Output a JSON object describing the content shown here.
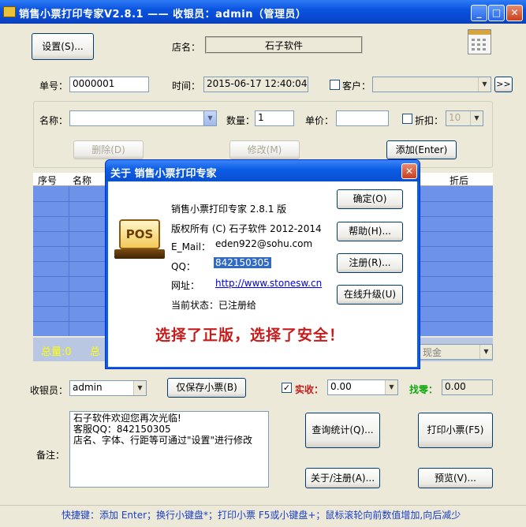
{
  "window": {
    "title": "销售小票打印专家V2.8.1 —— 收银员：admin（管理员）",
    "min": "_",
    "max": "□",
    "close": "✕"
  },
  "toolbar": {
    "settings_button": "设置(S)...",
    "store_label": "店名：",
    "store_name": "石子软件"
  },
  "order": {
    "number_label": "单号：",
    "number_value": "0000001",
    "time_label": "时间：",
    "time_value": "2015-06-17 12:40:04",
    "customer_label": "客户：",
    "customer_value": "",
    "more_button": ">>"
  },
  "item": {
    "name_label": "名称：",
    "name_value": "",
    "qty_label": "数量：",
    "qty_value": "1",
    "price_label": "单价：",
    "price_value": "",
    "discount_label": "折扣：",
    "discount_value": "10",
    "delete_button": "删除(D)",
    "modify_button": "修改(M)",
    "add_button": "添加(Enter)"
  },
  "grid": {
    "col_seq": "序号",
    "col_name": "名称",
    "col_after": "折后"
  },
  "totals": {
    "total_qty": "总量:0",
    "total_amount_partial": "总",
    "payment_method": "现金"
  },
  "bottom": {
    "cashier_label": "收银员：",
    "cashier_value": "admin",
    "save_only_button": "仅保存小票(B)",
    "received_label": "实收：",
    "received_value": "0.00",
    "change_label": "找零：",
    "change_value": "0.00",
    "note_label": "备注：",
    "note_text": "石子软件欢迎您再次光临!\n客服QQ：842150305\n店名、字体、行距等可通过\"设置\"进行修改",
    "query_button": "查询统计(Q)...",
    "print_button": "打印小票(F5)",
    "about_button": "关于/注册(A)...",
    "preview_button": "预览(V)..."
  },
  "statusbar": {
    "text": "快捷键：添加 Enter；换行小键盘*；打印小票 F5或小键盘+；鼠标滚轮向前数值增加,向后减少"
  },
  "dialog": {
    "title": "关于 销售小票打印专家",
    "close": "✕",
    "icon_text": "POS",
    "product": "销售小票打印专家 2.8.1 版",
    "copyright": "版权所有 (C) 石子软件 2012-2014",
    "email_label": "E_Mail：",
    "email": "eden922@sohu.com",
    "qq_label": "QQ：",
    "qq": "842150305",
    "site_label": "网址：",
    "site": "http://www.stonesw.cn",
    "status": "当前状态：已注册给",
    "slogan": "选择了正版，选择了安全！",
    "ok_button": "确定(O)",
    "help_button": "帮助(H)...",
    "register_button": "注册(R)...",
    "upgrade_button": "在线升级(U)"
  }
}
